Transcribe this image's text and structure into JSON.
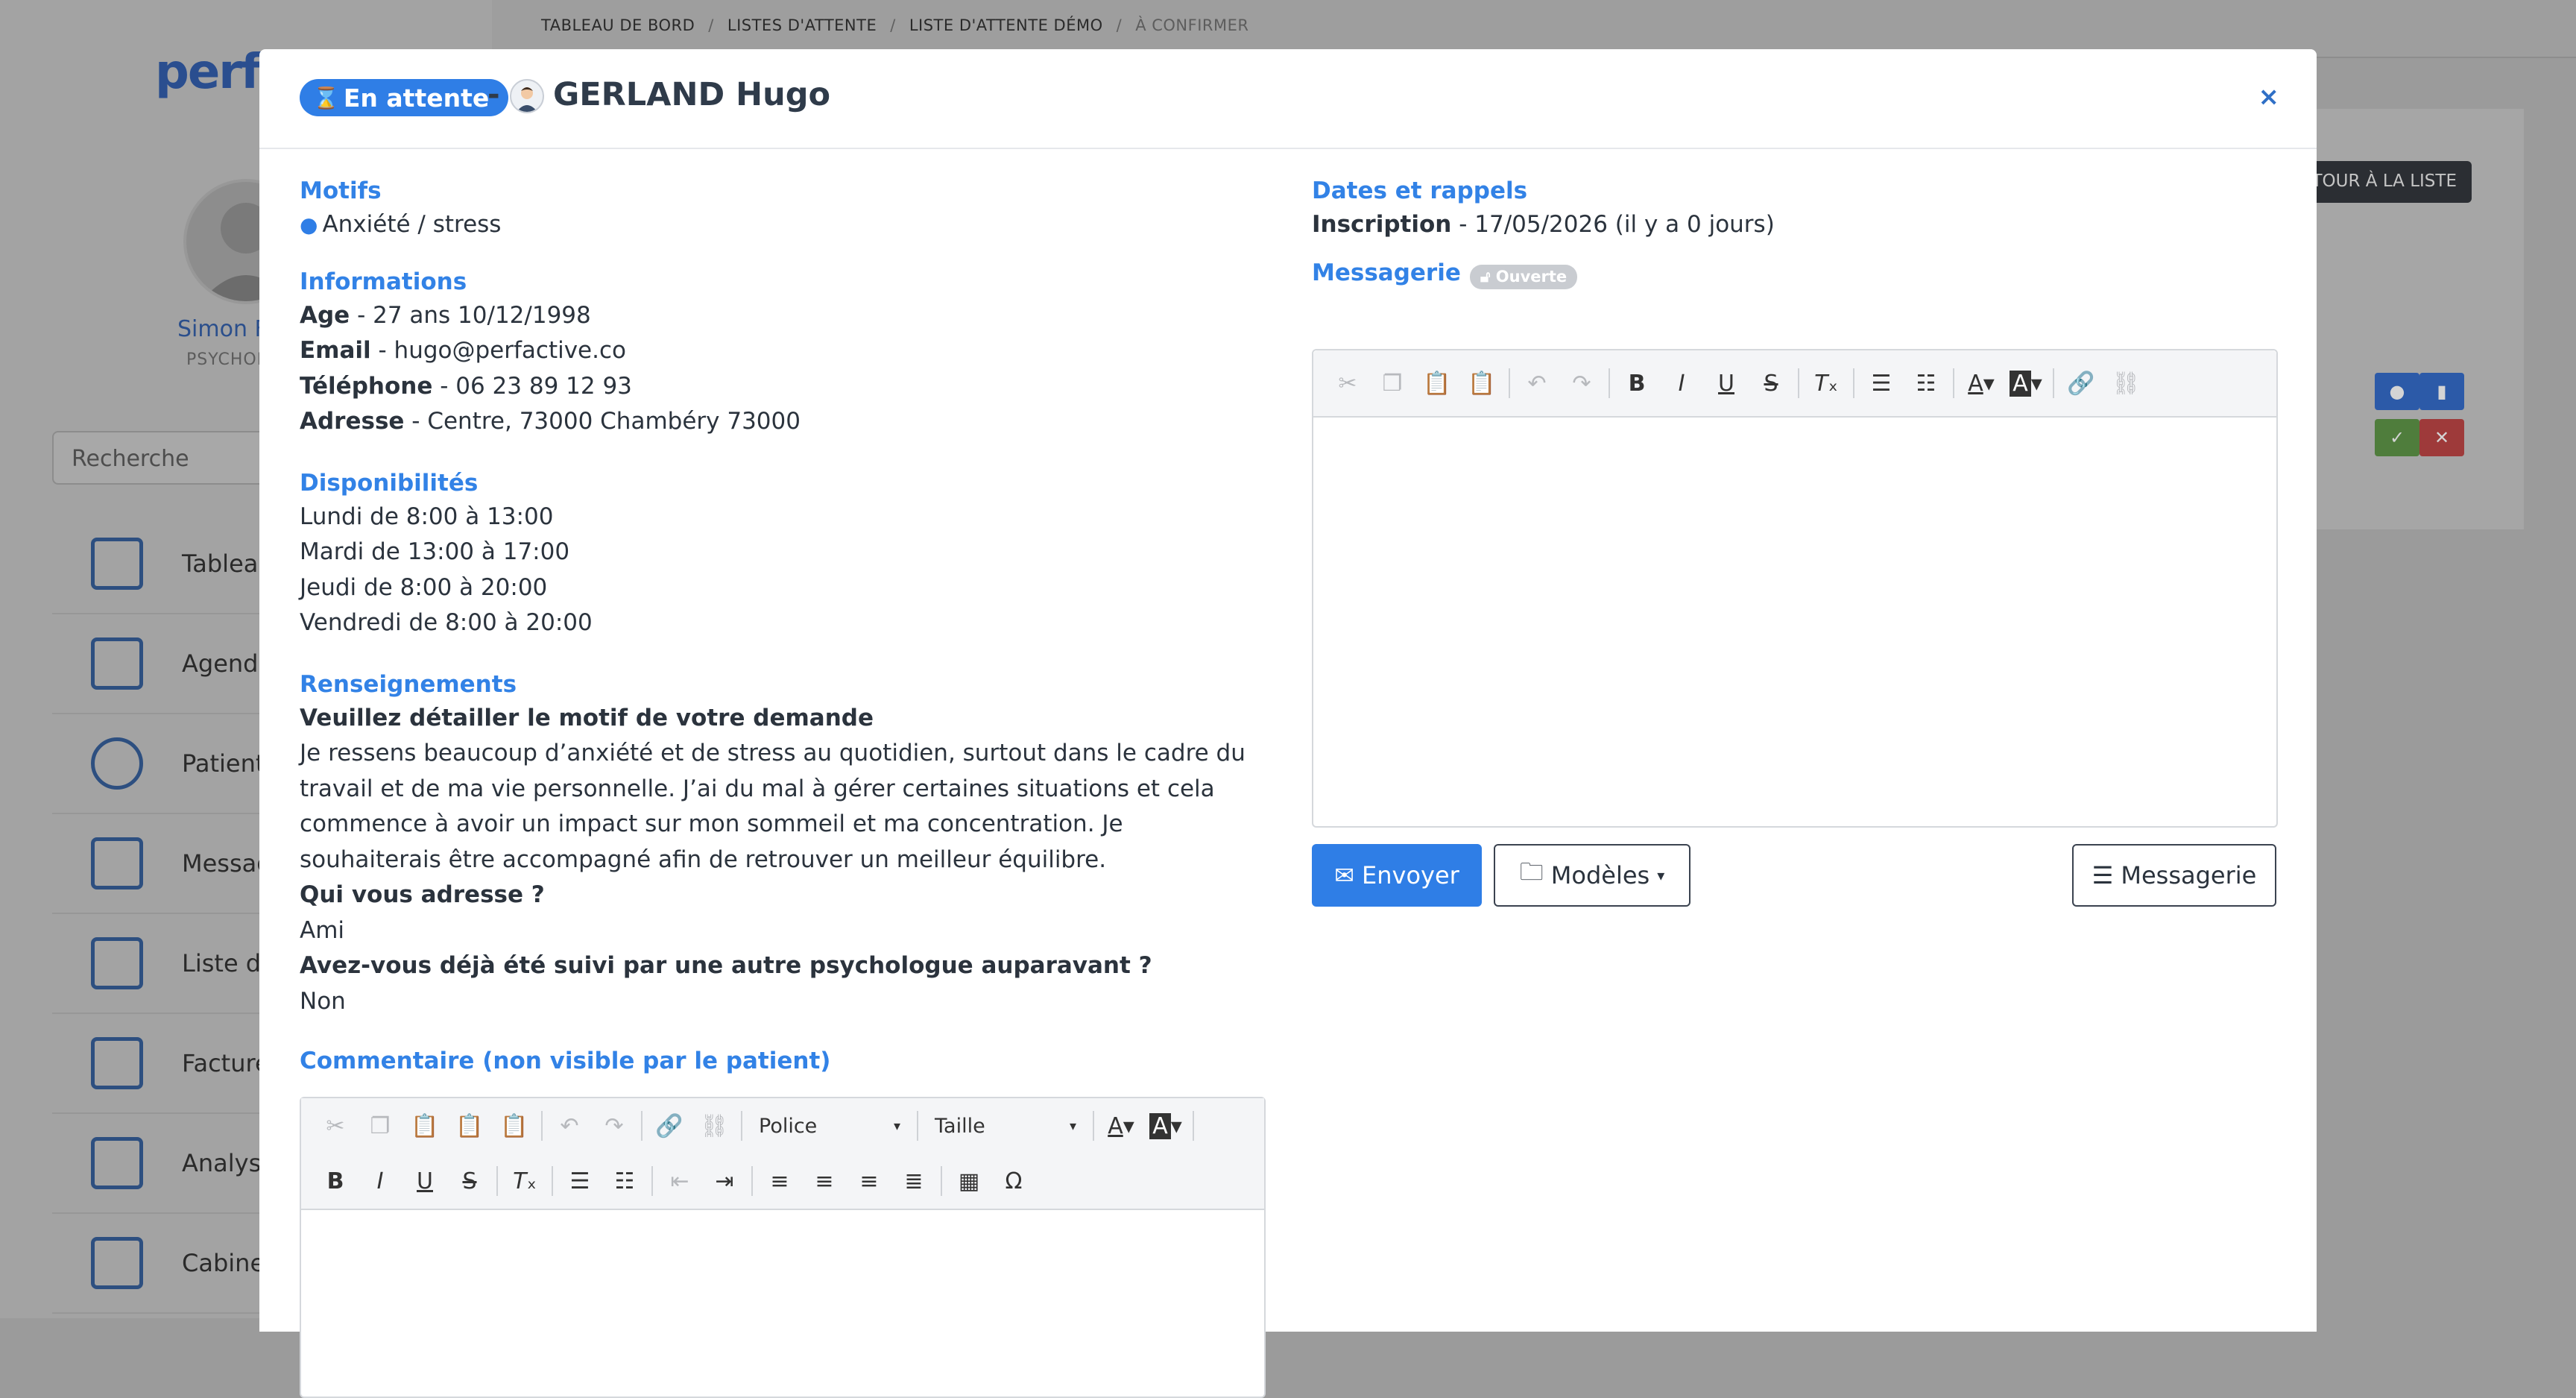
{
  "background": {
    "logo": "perfac",
    "user_name": "Simon F",
    "user_role": "PSYCHOL",
    "search_placeholder": "Recherche",
    "nav": [
      {
        "label": "Tableau",
        "icon": "dashboard-icon"
      },
      {
        "label": "Agenda",
        "icon": "calendar-icon"
      },
      {
        "label": "Patient",
        "icon": "user-circle-icon"
      },
      {
        "label": "Messag",
        "icon": "envelope-icon"
      },
      {
        "label": "Liste d'",
        "icon": "clipboard-list-icon"
      },
      {
        "label": "Facture",
        "icon": "invoice-icon"
      },
      {
        "label": "Analys",
        "icon": "chart-icon"
      },
      {
        "label": "Cabine",
        "icon": "box-icon"
      }
    ],
    "breadcrumb": [
      "TABLEAU DE BORD",
      "LISTES D'ATTENTE",
      "LISTE D'ATTENTE DÉMO",
      "À CONFIRMER"
    ],
    "back_button": "TOUR À LA LISTE"
  },
  "modal": {
    "status": "En attente",
    "dash": "-",
    "patient_name": "GERLAND Hugo",
    "close": "×",
    "motifs": {
      "title": "Motifs",
      "tag": "Anxiété / stress"
    },
    "informations": {
      "title": "Informations",
      "rows": [
        {
          "label": "Age",
          "value": " - 27 ans 10/12/1998"
        },
        {
          "label": "Email",
          "value": " - hugo@perfactive.co"
        },
        {
          "label": "Téléphone",
          "value": " - 06 23 89 12 93"
        },
        {
          "label": "Adresse",
          "value": " - Centre, 73000 Chambéry 73000"
        }
      ]
    },
    "disponibilites": {
      "title": "Disponibilités",
      "items": [
        "Lundi de 8:00 à 13:00",
        "Mardi de 13:00 à 17:00",
        "Jeudi de 8:00 à 20:00",
        "Vendredi de 8:00 à 20:00"
      ]
    },
    "renseignements": {
      "title": "Renseignements",
      "q1": "Veuillez détailler le motif de votre demande",
      "a1": "Je ressens beaucoup d’anxiété et de stress au quotidien, surtout dans le cadre du travail et de ma vie personnelle. J’ai du mal à gérer certaines situations et cela commence à avoir un impact sur mon sommeil et ma concentration. Je souhaiterais être accompagné afin de retrouver un meilleur équilibre.",
      "q2": "Qui vous adresse ?",
      "a2": "Ami",
      "q3": "Avez-vous déjà été suivi par une autre psychologue auparavant ?",
      "a3": "Non"
    },
    "commentaire": {
      "title": "Commentaire (non visible par le patient)",
      "font_placeholder": "Police",
      "size_placeholder": "Taille"
    },
    "dates": {
      "title": "Dates et rappels",
      "label": "Inscription",
      "value": " - 17/05/2026 (il y a 0 jours)"
    },
    "messagerie": {
      "title": "Messagerie",
      "badge": "Ouverte",
      "send_button": "Envoyer",
      "templates_button": "Modèles",
      "messagerie_button": "Messagerie"
    }
  }
}
